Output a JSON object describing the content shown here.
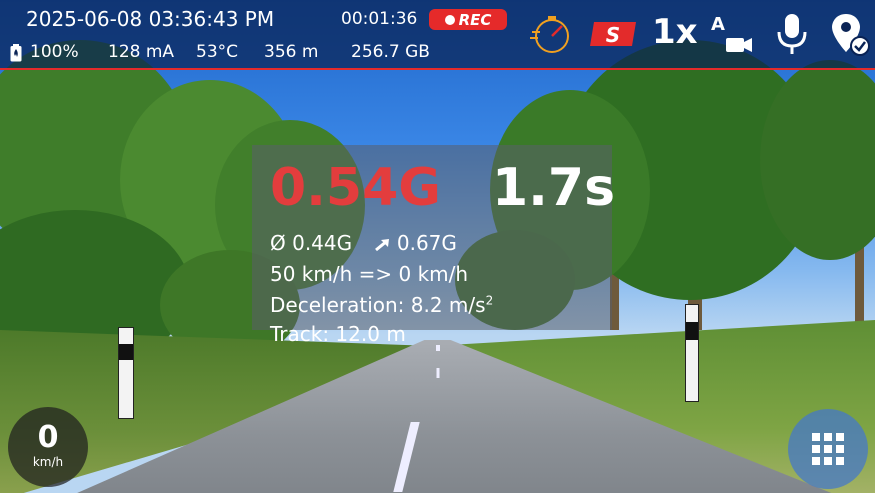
{
  "status_bar": {
    "datetime": "2025-06-08 03:36:43 PM",
    "elapsed": "00:01:36",
    "rec_label": "REC",
    "battery": "100%",
    "current": "128 mA",
    "temperature": "53°C",
    "distance": "356 m",
    "storage": "256.7 GB",
    "icons": {
      "battery": "battery-icon",
      "speedometer": "speedometer-icon",
      "brand": "s-brand-logo",
      "zoom": "1x",
      "auto_camera": "auto-camera-icon",
      "microphone": "microphone-icon",
      "location": "location-check-icon"
    },
    "accent_color": "#e32b2b"
  },
  "g_meter": {
    "g_force": "0.54G",
    "time": "1.7s",
    "avg_g": "Ø 0.44G",
    "peak_g": "0.67G",
    "speed_change": "50 km/h => 0 km/h",
    "deceleration_label": "Deceleration: 8.2 m/s",
    "deceleration_exp": "2",
    "track": "Track: 12.0 m",
    "g_color": "#e33d3d"
  },
  "speed": {
    "value": "0",
    "unit": "km/h"
  },
  "menu": {
    "icon": "grid-menu-icon"
  }
}
